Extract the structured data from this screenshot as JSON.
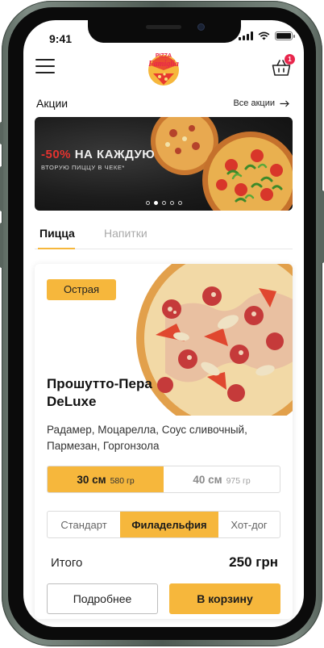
{
  "status": {
    "time": "9:41",
    "signal_icon": "cellular-signal-icon",
    "wifi_icon": "wifi-icon",
    "battery_icon": "battery-icon"
  },
  "header": {
    "menu_icon": "hamburger-menu-icon",
    "logo": {
      "line1": "PIZZA",
      "line2": "Famiglia"
    },
    "cart_icon": "shopping-basket-icon",
    "cart_count": "1"
  },
  "promos": {
    "title": "Акции",
    "all_label": "Все акции",
    "all_icon": "arrow-right-icon",
    "banner": {
      "discount": "-50%",
      "headline": "НА КАЖДУЮ",
      "subline": "ВТОРУЮ ПИЦЦУ В ЧЕКЕ*"
    },
    "slide_count": 5,
    "active_slide": 2
  },
  "categories": {
    "tabs": [
      {
        "label": "Пицца",
        "active": true
      },
      {
        "label": "Напитки",
        "active": false
      }
    ]
  },
  "product": {
    "badge": "Острая",
    "name": "Прошутто-Пера DeLuxe",
    "description": "Радамер, Моцарелла, Соус сливочный, Пармезан, Горгонзола",
    "sizes": [
      {
        "size": "30 см",
        "weight": "580 гр",
        "active": true
      },
      {
        "size": "40 см",
        "weight": "975 гр",
        "active": false
      }
    ],
    "crusts": [
      {
        "label": "Стандарт",
        "active": false
      },
      {
        "label": "Филадельфия",
        "active": true
      },
      {
        "label": "Хот-дог",
        "active": false
      }
    ],
    "total_label": "Итого",
    "total_value": "250 грн",
    "more_button": "Подробнее",
    "cart_button": "В корзину"
  },
  "colors": {
    "accent": "#f6b73c",
    "badge_red": "#e8264c",
    "promo_red": "#e5322f"
  }
}
